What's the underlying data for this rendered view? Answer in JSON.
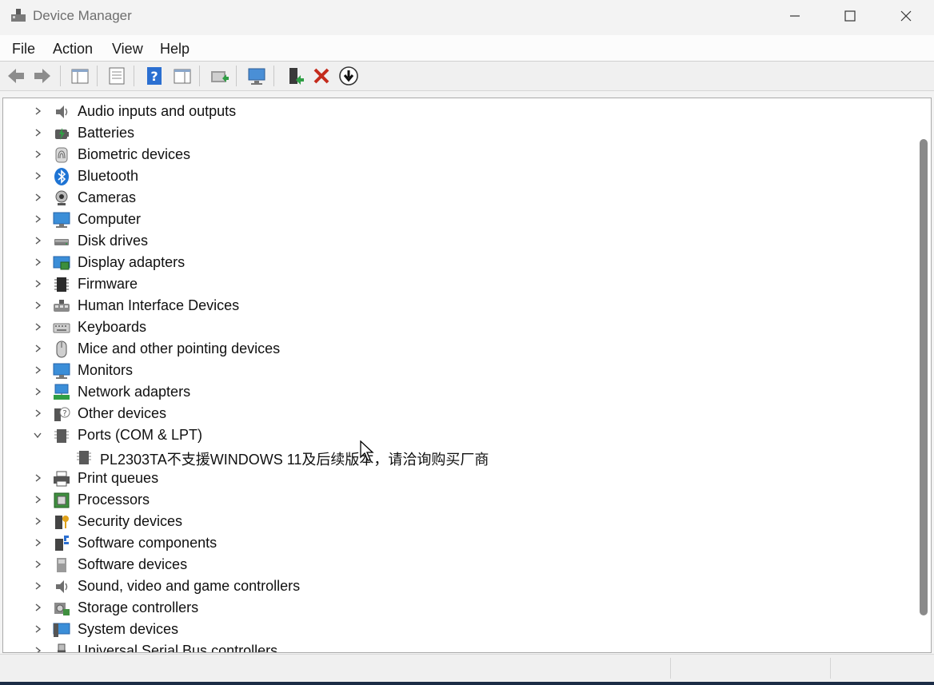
{
  "window": {
    "title": "Device Manager",
    "controls": {
      "minimize": "–",
      "maximize": "□",
      "close": "✕"
    }
  },
  "menu": [
    "File",
    "Action",
    "View",
    "Help"
  ],
  "toolbar": {
    "buttons": [
      "back-arrow-icon",
      "forward-arrow-icon",
      "show-hide-console-tree-icon",
      "properties-icon",
      "help-icon",
      "action-pane-icon",
      "update-driver-icon",
      "scan-hardware-changes-icon",
      "enable-device-icon",
      "uninstall-device-icon",
      "disable-device-icon"
    ],
    "uninstall_color": "#c42b1c"
  },
  "tree": {
    "categories": [
      {
        "label": "Audio inputs and outputs",
        "icon": "speaker-icon"
      },
      {
        "label": "Batteries",
        "icon": "battery-icon"
      },
      {
        "label": "Biometric devices",
        "icon": "fingerprint-icon"
      },
      {
        "label": "Bluetooth",
        "icon": "bluetooth-icon"
      },
      {
        "label": "Cameras",
        "icon": "camera-icon"
      },
      {
        "label": "Computer",
        "icon": "computer-icon"
      },
      {
        "label": "Disk drives",
        "icon": "disk-drive-icon"
      },
      {
        "label": "Display adapters",
        "icon": "display-adapter-icon"
      },
      {
        "label": "Firmware",
        "icon": "firmware-icon"
      },
      {
        "label": "Human Interface Devices",
        "icon": "hid-icon"
      },
      {
        "label": "Keyboards",
        "icon": "keyboard-icon"
      },
      {
        "label": "Mice and other pointing devices",
        "icon": "mouse-icon"
      },
      {
        "label": "Monitors",
        "icon": "monitor-icon"
      },
      {
        "label": "Network adapters",
        "icon": "network-adapter-icon"
      },
      {
        "label": "Other devices",
        "icon": "unknown-device-icon"
      },
      {
        "label": "Ports (COM & LPT)",
        "icon": "port-icon",
        "expanded": true,
        "children": [
          {
            "label": "PL2303TA不支援WINDOWS 11及后续版本，请洽询购买厂商",
            "icon": "port-icon"
          }
        ]
      },
      {
        "label": "Print queues",
        "icon": "printer-icon"
      },
      {
        "label": "Processors",
        "icon": "processor-icon"
      },
      {
        "label": "Security devices",
        "icon": "security-device-icon"
      },
      {
        "label": "Software components",
        "icon": "software-component-icon"
      },
      {
        "label": "Software devices",
        "icon": "software-device-icon"
      },
      {
        "label": "Sound, video and game controllers",
        "icon": "sound-controller-icon"
      },
      {
        "label": "Storage controllers",
        "icon": "storage-controller-icon"
      },
      {
        "label": "System devices",
        "icon": "system-devices-icon"
      },
      {
        "label": "Universal Serial Bus controllers",
        "icon": "usb-icon"
      }
    ]
  }
}
